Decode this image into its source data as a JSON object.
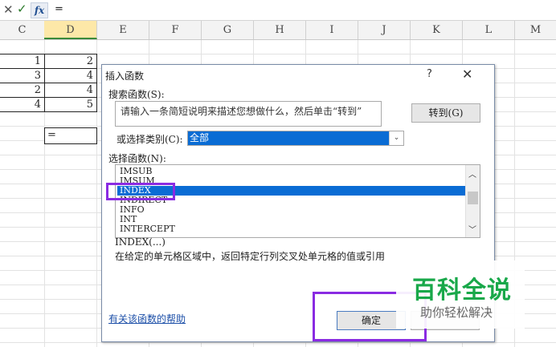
{
  "formula_bar": {
    "cancel_icon": "✕",
    "enter_icon": "✓",
    "fx_label": "fx",
    "content": "="
  },
  "columns": [
    "C",
    "D",
    "E",
    "F",
    "G",
    "H",
    "I",
    "J",
    "K",
    "L",
    "M"
  ],
  "selected_column": "D",
  "cells": {
    "c1": "1",
    "d1": "2",
    "c2": "3",
    "d2": "4",
    "c3": "2",
    "d3": "4",
    "c4": "4",
    "d4": "5"
  },
  "active_cell": {
    "value": "="
  },
  "dialog": {
    "title": "插入函数",
    "help_icon": "?",
    "close_icon": "✕",
    "search_label": "搜索函数(S):",
    "search_placeholder": "请输入一条简短说明来描述您想做什么，然后单击“转到”",
    "goto_label": "转到(G)",
    "category_label": "或选择类别(C):",
    "category_value": "全部",
    "select_label": "选择函数(N):",
    "functions": [
      "IMSUB",
      "IMSUM",
      "INDEX",
      "INDIRECT",
      "INFO",
      "INT",
      "INTERCEPT"
    ],
    "selected_function": "INDEX",
    "signature": "INDEX(...)",
    "description": "在给定的单元格区域中，返回特定行列交叉处单元格的值或引用",
    "help_link": "有关该函数的帮助",
    "ok_label": "确定"
  },
  "watermark": {
    "big": "百科全说",
    "small": "助你轻松解决"
  },
  "colors": {
    "selection_blue": "#0a6cd4",
    "annotation_purple": "#8a2be2",
    "watermark_green": "#19a84a",
    "link_blue": "#1c4fa8"
  }
}
